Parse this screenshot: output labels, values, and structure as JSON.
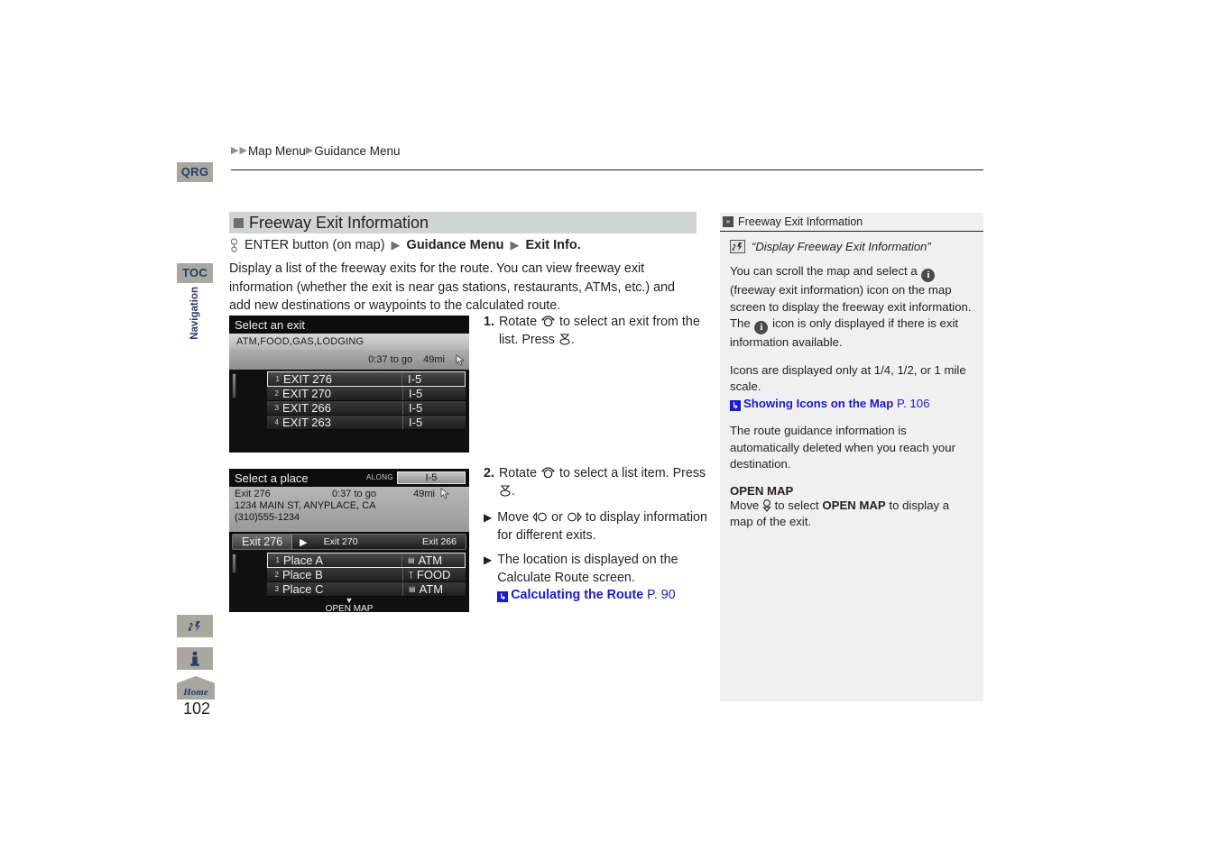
{
  "left_rail": {
    "tabs": [
      {
        "name": "qrg",
        "label": "QRG"
      },
      {
        "name": "toc",
        "label": "TOC"
      }
    ],
    "vertical_label": "Navigation",
    "icons": [
      {
        "name": "voice-command-icon",
        "glyph": "♪♂"
      },
      {
        "name": "info-icon",
        "glyph": "i"
      }
    ],
    "home_label": "Home",
    "page_number": "102"
  },
  "breadcrumb": {
    "triangle": "▶",
    "items": [
      "Map Menu",
      "Guidance Menu"
    ]
  },
  "section": {
    "heading": "Freeway Exit Information",
    "command": {
      "enter": "ENTER button (on map)",
      "step1": "Guidance Menu",
      "step2": "Exit Info.",
      "triangle": "▶"
    },
    "intro": "Display a list of the freeway exits for the route. You can view freeway exit information (whether the exit is near gas stations, restaurants, ATMs, etc.) and add new destinations or waypoints to the calculated route."
  },
  "nav_screen_1": {
    "title": "Select an exit",
    "categories": "ATM,FOOD,GAS,LODGING",
    "time_to_go": "0:37 to go",
    "distance": "49mi",
    "rows": [
      {
        "index": "1",
        "label": "EXIT 276",
        "right": "I-5",
        "selected": true
      },
      {
        "index": "2",
        "label": "EXIT 270",
        "right": "I-5",
        "selected": false
      },
      {
        "index": "3",
        "label": "EXIT 266",
        "right": "I-5",
        "selected": false
      },
      {
        "index": "4",
        "label": "EXIT 263",
        "right": "I-5",
        "selected": false
      }
    ]
  },
  "nav_screen_2": {
    "title": "Select a place",
    "along_label": "ALONG",
    "road": "I-5",
    "exit_name": "Exit 276",
    "time_to_go": "0:37 to go",
    "distance": "49mi",
    "address": "1234 MAIN ST, ANYPLACE, CA",
    "phone": "(310)555-1234",
    "tabs": {
      "selected": "Exit 276",
      "arrow": "▶",
      "next": "Exit 270",
      "after": "Exit 266"
    },
    "rows": [
      {
        "index": "1",
        "label": "Place A",
        "right": "ATM",
        "poi": "▤",
        "selected": true
      },
      {
        "index": "2",
        "label": "Place B",
        "right": "FOOD",
        "poi": "Ʈ",
        "selected": false
      },
      {
        "index": "3",
        "label": "Place C",
        "right": "ATM",
        "poi": "▤",
        "selected": false
      }
    ],
    "open_map": "OPEN MAP",
    "down_arrow": "▼"
  },
  "steps": [
    {
      "number": "1.",
      "text_a": "Rotate",
      "text_b": "to select an exit from the list. Press",
      "text_c": "."
    },
    {
      "number": "2.",
      "text_a": "Rotate",
      "text_b": "to select a list item. Press",
      "text_c": ".",
      "bullets": [
        {
          "triangle": "▶",
          "pre": "Move",
          "mid": "or",
          "post": "to display information for different exits."
        },
        {
          "triangle": "▶",
          "text": "The location is displayed on the Calculate Route screen.",
          "xref_arrow": "↳",
          "xref": "Calculating the Route",
          "xref_page": "P. 90"
        }
      ]
    }
  ],
  "right_panel": {
    "header": "Freeway Exit Information",
    "header_arrow": "»",
    "voice_quote": "“Display Freeway Exit Information”",
    "voice_icon": "♪♂",
    "para1_a": "You can scroll the map and select a",
    "para1_b": "(freeway exit information) icon on the map screen to display the freeway exit information. The",
    "para1_c": "icon is only displayed if there is exit information available.",
    "info_glyph": "i",
    "para2": "Icons are displayed only at 1/4, 1/2, or 1 mile scale.",
    "xref_arrow": "↳",
    "xref": "Showing Icons on the Map",
    "xref_page": "P. 106",
    "para3": "The route guidance information is automatically deleted when you reach your destination.",
    "subhead": "OPEN MAP",
    "para4_a": "Move",
    "para4_b": "to select",
    "para4_bold": "OPEN MAP",
    "para4_c": "to display a map of the exit."
  },
  "colors": {
    "rail_bg": "#a8a8a0",
    "rail_text": "#2b3a67",
    "heading_bg": "#d2d3d3",
    "link_blue": "#1a1ad2",
    "panel_bg": "#f0f0f0"
  }
}
